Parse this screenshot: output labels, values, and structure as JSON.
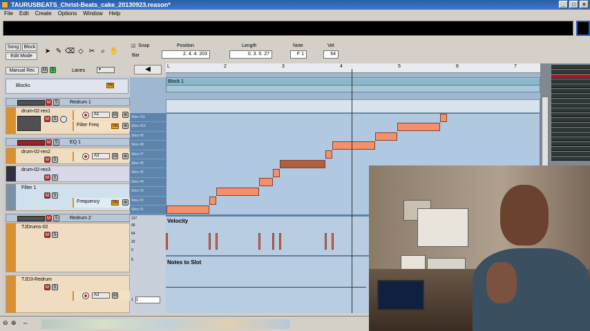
{
  "window": {
    "title": "TAURUSBEATS_Christ-Beats_cake_20130923.reason*"
  },
  "menu": [
    "File",
    "Edit",
    "Create",
    "Options",
    "Window",
    "Help"
  ],
  "toolbar": {
    "song_label": "Song",
    "block_label": "Block",
    "edit_mode": "Edit Mode",
    "snap_label": "Snap",
    "snap_value": "Bar",
    "position_label": "Position",
    "position_value": "2. 4. 4. 203",
    "length_label": "Length",
    "length_value": "0. 3. 0. 27",
    "note_label": "Note",
    "note_value": "F 1",
    "vel_label": "Vel",
    "vel_value": "64"
  },
  "sequencer": {
    "manual_rec": "Manual Rec",
    "lanes_label": "Lanes",
    "blocks_label": "Blocks",
    "block_name": "Block 1",
    "ruler": [
      "2",
      "3",
      "4",
      "5",
      "6",
      "7"
    ],
    "velocity_label": "Velocity",
    "notes_to_slot_label": "Notes to Slot",
    "vel_scale": [
      "127",
      "96",
      "64",
      "32",
      "0"
    ],
    "slot_scale": [
      "8",
      "1"
    ],
    "slot_value": "1",
    "slices": [
      "Slice #11",
      "Slice #10",
      "Slice #9",
      "Slice #8",
      "Slice #7",
      "Slice #6",
      "Slice #5",
      "Slice #4",
      "Slice #3",
      "Slice #2",
      "Slice #1"
    ]
  },
  "tracks": [
    {
      "name": "Redrum 1"
    },
    {
      "name": "drum-02-rex1",
      "sel": "A1",
      "param": "Filter Freq"
    },
    {
      "name": "EQ 1"
    },
    {
      "name": "drum-02-rex2",
      "sel": "A3"
    },
    {
      "name": "drum-02-rex3"
    },
    {
      "name": "Filter 1",
      "param": "Frequency"
    },
    {
      "name": "Redrum 2"
    },
    {
      "name": "TJDrums-02"
    },
    {
      "name": "TJD3-Redrum",
      "sel": "A3"
    }
  ],
  "buttons": {
    "m": "M",
    "s": "S",
    "on": "ON"
  }
}
